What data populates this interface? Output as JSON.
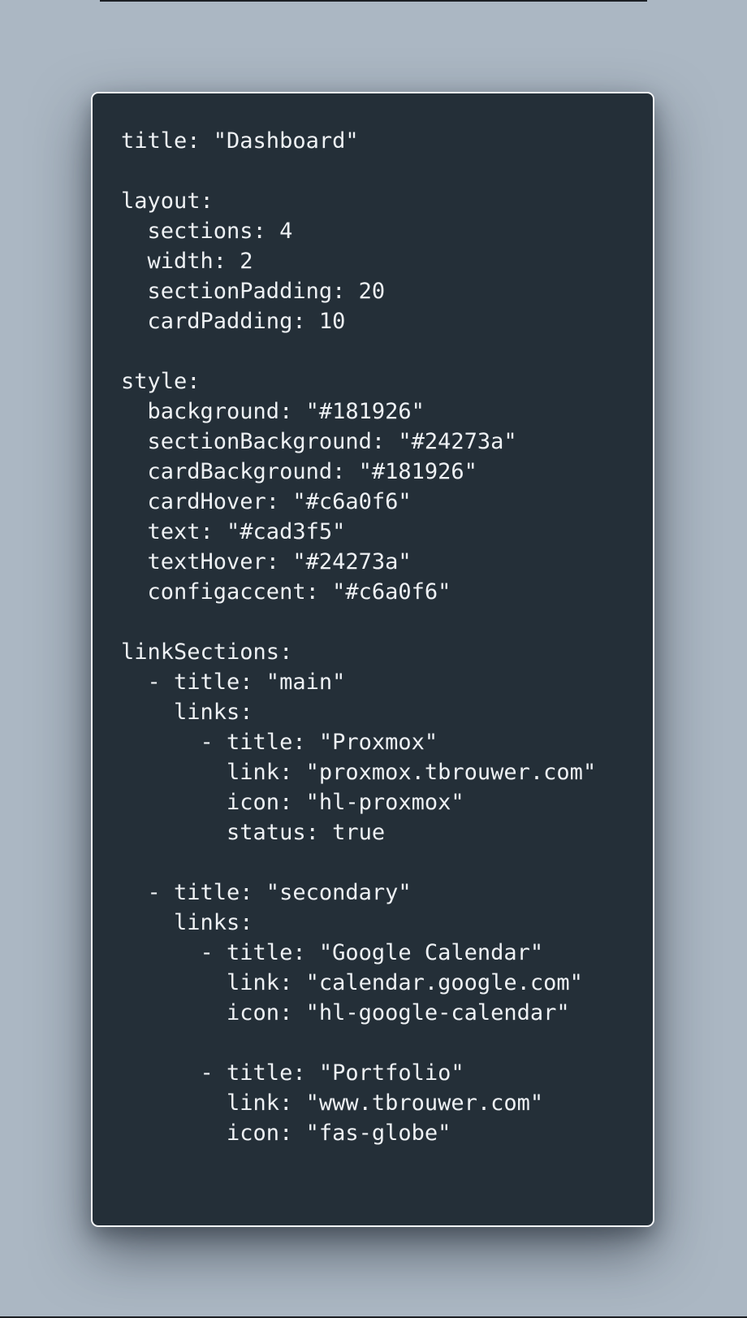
{
  "editor": {
    "lines": [
      "title: \"Dashboard\"",
      "",
      "layout:",
      "  sections: 4",
      "  width: 2",
      "  sectionPadding: 20",
      "  cardPadding: 10",
      "",
      "style:",
      "  background: \"#181926\"",
      "  sectionBackground: \"#24273a\"",
      "  cardBackground: \"#181926\"",
      "  cardHover: \"#c6a0f6\"",
      "  text: \"#cad3f5\"",
      "  textHover: \"#24273a\"",
      "  configaccent: \"#c6a0f6\"",
      "",
      "linkSections:",
      "  - title: \"main\"",
      "    links:",
      "      - title: \"Proxmox\"",
      "        link: \"proxmox.tbrouwer.com\"",
      "        icon: \"hl-proxmox\"",
      "        status: true",
      "",
      "  - title: \"secondary\"",
      "    links:",
      "      - title: \"Google Calendar\"",
      "        link: \"calendar.google.com\"",
      "        icon: \"hl-google-calendar\"",
      "",
      "      - title: \"Portfolio\"",
      "        link: \"www.tbrouwer.com\"",
      "        icon: \"fas-globe\""
    ]
  },
  "colors": {
    "page_background": "#abb7c3",
    "window_background": "#242f38",
    "window_border": "#f2f4f6",
    "code_text": "#eef1f4"
  }
}
